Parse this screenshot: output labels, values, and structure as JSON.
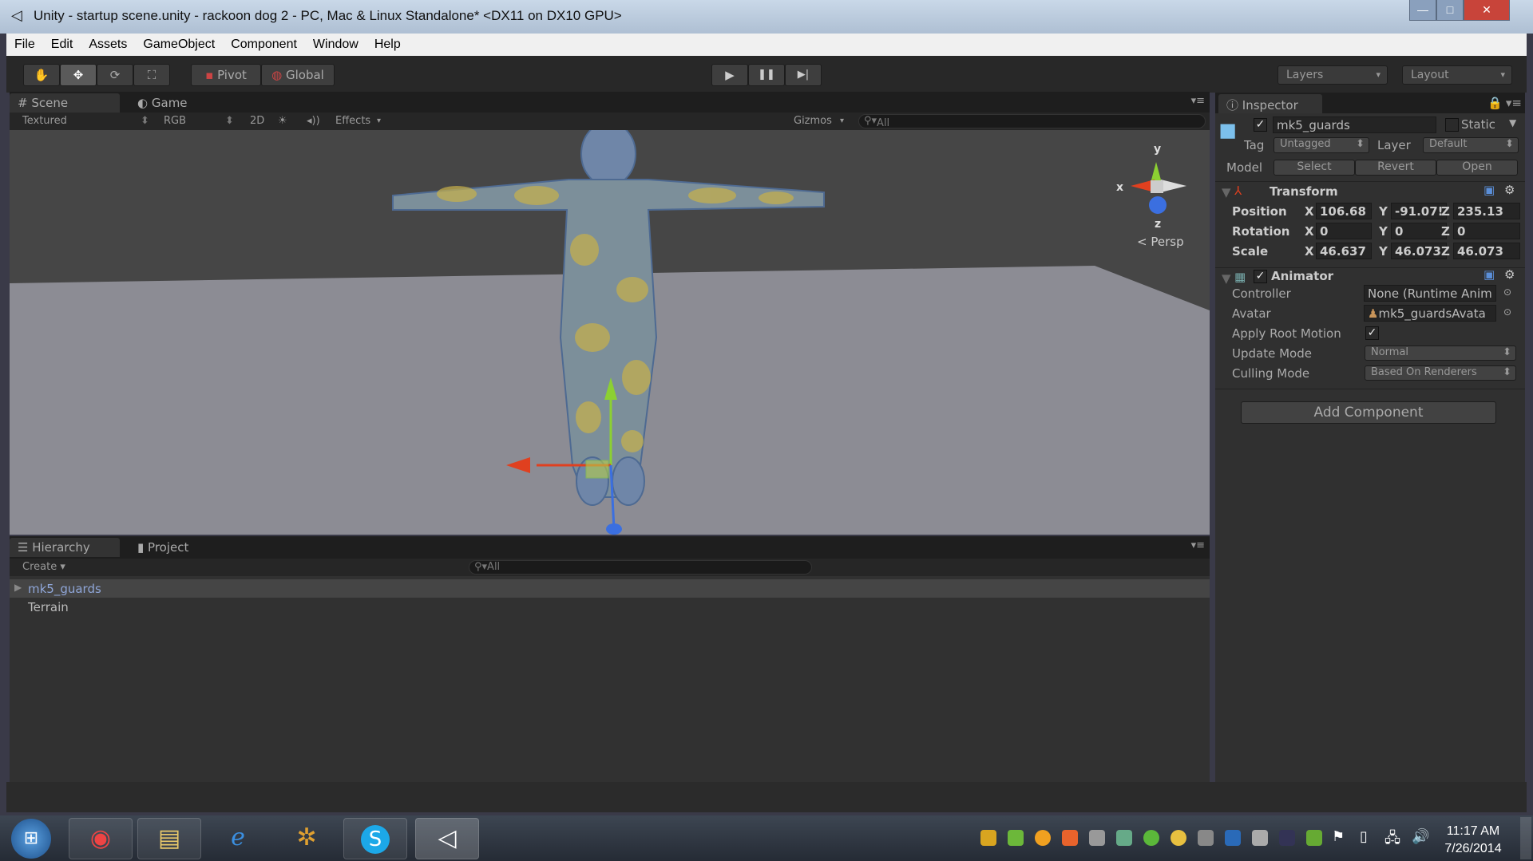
{
  "window": {
    "title": "Unity - startup scene.unity -  rackoon dog 2 - PC, Mac & Linux Standalone* <DX11 on DX10 GPU>",
    "minimize": "—",
    "maximize": "□",
    "close": "✕"
  },
  "menu": [
    "File",
    "Edit",
    "Assets",
    "GameObject",
    "Component",
    "Window",
    "Help"
  ],
  "toolbar": {
    "tools": [
      "hand-tool",
      "move-tool",
      "rotate-tool",
      "scale-tool"
    ],
    "pivot": "Pivot",
    "global": "Global",
    "play": "▶",
    "pause": "❚❚",
    "step": "▶|",
    "layers": "Layers",
    "layout": "Layout"
  },
  "scene": {
    "tabs": [
      "Scene",
      "Game"
    ],
    "render_mode": "Textured",
    "color_mode": "RGB",
    "mode_2d": "2D",
    "effects": "Effects",
    "gizmos": "Gizmos",
    "search_placeholder": "All",
    "gizmo_axes": {
      "x": "x",
      "y": "y",
      "z": "z"
    },
    "projection": "Persp"
  },
  "hierarchy": {
    "tabs": [
      "Hierarchy",
      "Project"
    ],
    "create": "Create",
    "search_placeholder": "All",
    "items": [
      {
        "name": "mk5_guards",
        "selected": true,
        "expandable": true
      },
      {
        "name": "Terrain",
        "selected": false,
        "expandable": false
      }
    ]
  },
  "inspector": {
    "tab": "Inspector",
    "object_name": "mk5_guards",
    "active": true,
    "static_label": "Static",
    "static": false,
    "tag_label": "Tag",
    "tag": "Untagged",
    "layer_label": "Layer",
    "layer": "Default",
    "model_label": "Model",
    "model_buttons": [
      "Select",
      "Revert",
      "Open"
    ],
    "transform": {
      "title": "Transform",
      "rows": [
        {
          "label": "Position",
          "x": "106.68",
          "y": "-91.07!",
          "z": "235.13"
        },
        {
          "label": "Rotation",
          "x": "0",
          "y": "0",
          "z": "0"
        },
        {
          "label": "Scale",
          "x": "46.637",
          "y": "46.073",
          "z": "46.073"
        }
      ],
      "axis": [
        "X",
        "Y",
        "Z"
      ]
    },
    "animator": {
      "title": "Animator",
      "enabled": true,
      "controller_label": "Controller",
      "controller": "None (Runtime Anim",
      "avatar_label": "Avatar",
      "avatar": "mk5_guardsAvata",
      "root_motion_label": "Apply Root Motion",
      "root_motion": true,
      "update_label": "Update Mode",
      "update": "Normal",
      "culling_label": "Culling Mode",
      "culling": "Based On Renderers"
    },
    "add_component": "Add Component"
  },
  "taskbar": {
    "apps": [
      "start",
      "chrome",
      "explorer",
      "internet-explorer",
      "game-app",
      "skype",
      "unity"
    ],
    "time": "11:17 AM",
    "date": "7/26/2014"
  },
  "colors": {
    "selection_text": "#8fa6d8",
    "axis_x": "#e0401f",
    "axis_y": "#8cd032",
    "axis_z": "#3b6fe0"
  }
}
